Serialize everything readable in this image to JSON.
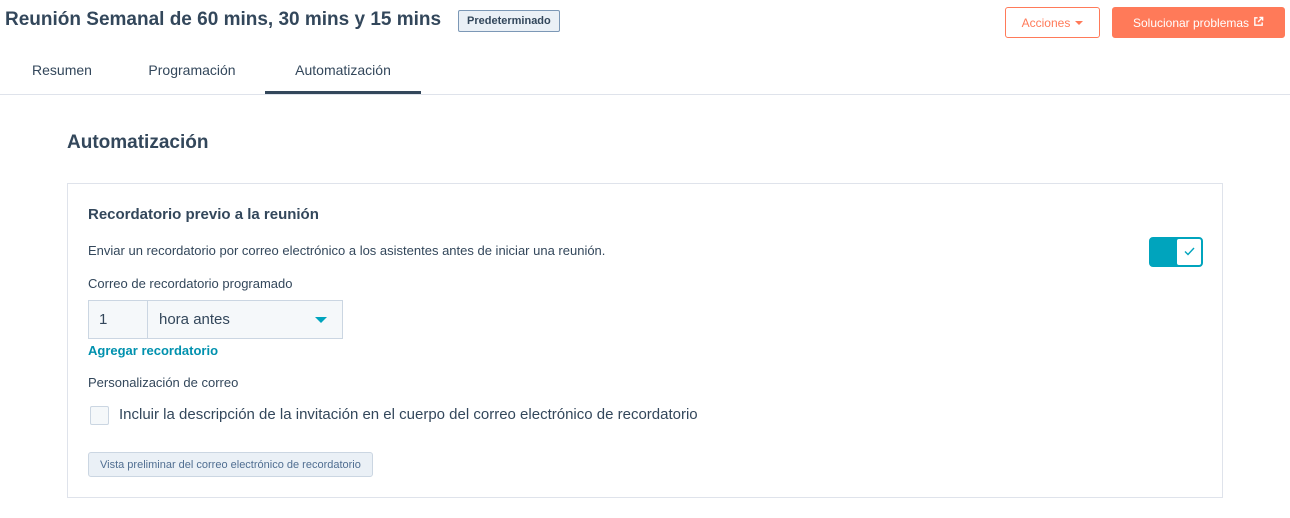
{
  "header": {
    "title": "Reunión Semanal de 60 mins, 30 mins y 15 mins",
    "badge": "Predeterminado",
    "actions_label": "Acciones",
    "troubleshoot_label": "Solucionar problemas"
  },
  "tabs": [
    {
      "label": "Resumen",
      "active": false
    },
    {
      "label": "Programación",
      "active": false
    },
    {
      "label": "Automatización",
      "active": true
    }
  ],
  "section": {
    "heading": "Automatización"
  },
  "card": {
    "title": "Recordatorio previo a la reunión",
    "description": "Enviar un recordatorio por correo electrónico a los asistentes antes de iniciar una reunión.",
    "toggle_on": true,
    "scheduled_label": "Correo de recordatorio programado",
    "reminder_value": "1",
    "reminder_unit": "hora antes",
    "add_reminder_link": "Agregar recordatorio",
    "customization_label": "Personalización de correo",
    "include_description_label": "Incluir la descripción de la invitación en el cuerpo del correo electrónico de recordatorio",
    "include_description_checked": false,
    "preview_button": "Vista preliminar del correo electrónico de recordatorio"
  },
  "icons": {
    "actions": "caret-down-icon",
    "troubleshoot": "external-link-icon",
    "toggle": "check-icon",
    "select": "caret-down-icon"
  },
  "colors": {
    "accent_orange": "#ff7a59",
    "accent_teal": "#00a4bd",
    "link": "#0091ae",
    "text": "#33475b"
  }
}
